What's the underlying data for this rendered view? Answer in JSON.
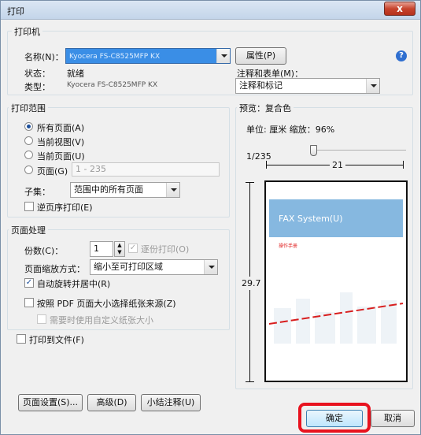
{
  "window": {
    "title": "打印",
    "close": "x"
  },
  "printer": {
    "group_label": "打印机",
    "name_label": "名称(N)：",
    "name_value": "Kyocera FS-C8525MFP KX",
    "properties_button": "属性(P)",
    "status_label": "状态：",
    "status_value": "就绪",
    "type_label": "类型：",
    "type_value": "Kyocera FS-C8525MFP KX",
    "annotations_label": "注释和表单(M)：",
    "annotations_value": "注释和标记",
    "help_icon": "?"
  },
  "range": {
    "group_label": "打印范围",
    "all_pages": "所有页面(A)",
    "current_view": "当前视图(V)",
    "current_page": "当前页面(U)",
    "pages": "页面(G)",
    "pages_value": "1 - 235",
    "subset_label": "子集：",
    "subset_value": "范围中的所有页面",
    "reverse": "逆页序打印(E)"
  },
  "handling": {
    "group_label": "页面处理",
    "copies_label": "份数(C)：",
    "copies_value": "1",
    "collate": "逐份打印(O)",
    "scaling_label": "页面缩放方式：",
    "scaling_value": "缩小至可打印区域",
    "auto_rotate": "自动旋转并居中(R)",
    "pdf_paper": "按照 PDF 页面大小选择纸张来源(Z)",
    "custom_paper": "需要时使用自定义纸张大小"
  },
  "print_to_file": "打印到文件(F)",
  "preview": {
    "group_label": "预览：复合色",
    "units_zoom": "单位: 厘米 缩放：96%",
    "page_counter": "1/235",
    "width_dim": "21",
    "height_dim": "29.7",
    "page_title": "FAX System(U)",
    "page_subtitle": "操作手册",
    "accent_color": "#86b8e0"
  },
  "footer": {
    "page_setup": "页面设置(S)...",
    "advanced": "高级(D)",
    "summarize": "小结注释(U)",
    "ok": "确定",
    "cancel": "取消"
  }
}
